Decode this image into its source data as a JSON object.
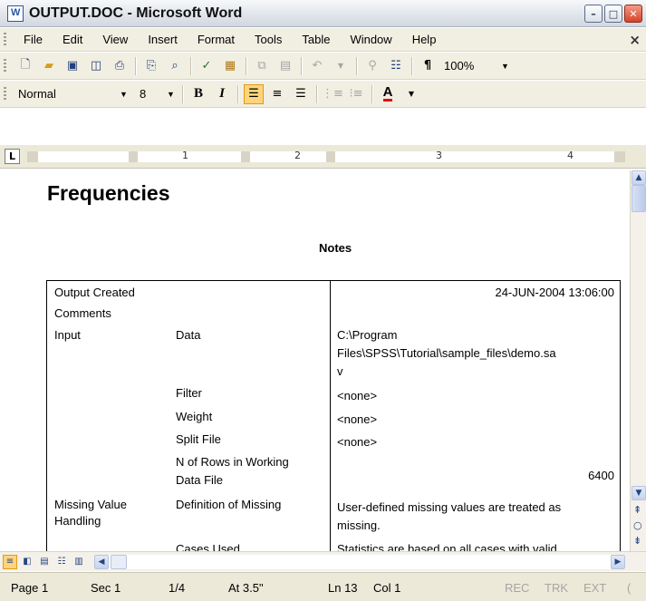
{
  "window": {
    "title": "OUTPUT.DOC - Microsoft Word",
    "minimize": "–",
    "maximize": "□",
    "close": "✕",
    "doc_close": "×"
  },
  "menu": [
    "File",
    "Edit",
    "View",
    "Insert",
    "Format",
    "Tools",
    "Table",
    "Window",
    "Help"
  ],
  "toolbar": {
    "zoom": "100%",
    "style": "Normal",
    "font_size": "8",
    "bold": "B",
    "italic": "I",
    "font_color_label": "A",
    "font_color": "#e01010"
  },
  "ruler": {
    "tab_selector": "L",
    "numbers": [
      "1",
      "2",
      "3",
      "4"
    ]
  },
  "document": {
    "heading": "Frequencies",
    "table_title": "Notes",
    "rows": {
      "output_created": {
        "label": "Output Created",
        "value": "24-JUN-2004 13:06:00"
      },
      "comments": {
        "label": "Comments"
      },
      "input_data": {
        "label": "Input",
        "sublabel": "Data",
        "value_lines": [
          "C:\\Program",
          "Files\\SPSS\\Tutorial\\sample_files\\demo.sa",
          "v"
        ]
      },
      "filter": {
        "sublabel": "Filter",
        "value": "<none>"
      },
      "weight": {
        "sublabel": "Weight",
        "value": "<none>"
      },
      "split_file": {
        "sublabel": "Split File",
        "value": "<none>"
      },
      "n_rows": {
        "sublabel_lines": [
          "N of Rows in Working",
          "Data File"
        ],
        "value": "6400"
      },
      "missing": {
        "label_lines": [
          "Missing Value",
          "Handling"
        ],
        "sublabel": "Definition of Missing",
        "value_lines": [
          "User-defined missing values are treated as",
          "missing."
        ]
      },
      "cases_used": {
        "sublabel": "Cases Used",
        "value": "Statistics are based on all cases with valid"
      }
    }
  },
  "statusbar": {
    "page": "Page 1",
    "section": "Sec 1",
    "pages": "1/4",
    "at": "At 3.5\"",
    "line": "Ln 13",
    "col": "Col 1",
    "rec": "REC",
    "trk": "TRK",
    "ext": "EXT",
    "ovr": "("
  }
}
